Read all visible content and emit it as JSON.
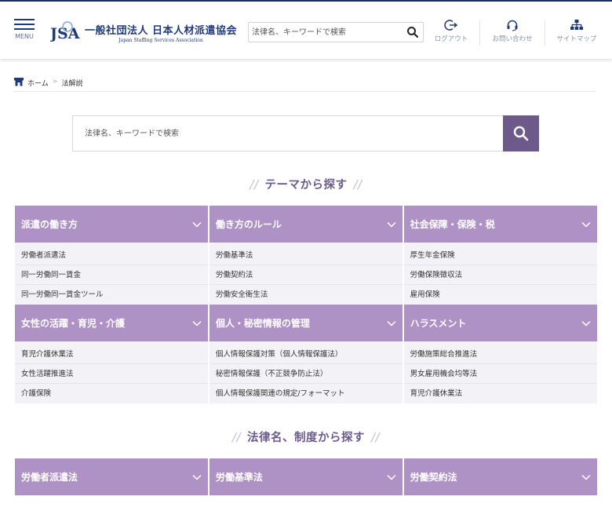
{
  "header": {
    "menu_label": "MENU",
    "logo_mark": "JSA",
    "logo_jp": "一般社団法人 日本人材派遣協会",
    "logo_en": "Japan Staffing Services Association",
    "search_placeholder": "法律名、キーワードで検索",
    "links": [
      {
        "label": "ログアウト",
        "icon": "logout-icon"
      },
      {
        "label": "お問い合わせ",
        "icon": "headset-icon"
      },
      {
        "label": "サイトマップ",
        "icon": "sitemap-icon"
      }
    ]
  },
  "breadcrumb": {
    "home": "ホーム",
    "separator": ">",
    "current": "法解説"
  },
  "search": {
    "placeholder": "法律名、キーワードで検索"
  },
  "theme_section": {
    "title": "テーマから探す",
    "rows": [
      [
        {
          "title": "派遣の働き方",
          "items": [
            "労働者派遣法",
            "同一労働同一賃金",
            "同一労働同一賃金ツール"
          ]
        },
        {
          "title": "働き方のルール",
          "items": [
            "労働基準法",
            "労働契約法",
            "労働安全衛生法"
          ]
        },
        {
          "title": "社会保障・保険・税",
          "items": [
            "厚生年金保険",
            "労働保険徴収法",
            "雇用保険"
          ]
        }
      ],
      [
        {
          "title": "女性の活躍・育児・介護",
          "items": [
            "育児介護休業法",
            "女性活躍推進法",
            "介護保険"
          ]
        },
        {
          "title": "個人・秘密情報の管理",
          "items": [
            "個人情報保護対策（個人情報保護法）",
            "秘密情報保護（不正競争防止法）",
            "個人情報保護関連の規定/フォーマット"
          ]
        },
        {
          "title": "ハラスメント",
          "items": [
            "労働施策総合推進法",
            "男女雇用機会均等法",
            "育児介護休業法"
          ]
        }
      ]
    ]
  },
  "law_section": {
    "title": "法律名、制度から探す",
    "rows": [
      [
        {
          "title": "労働者派遣法"
        },
        {
          "title": "労働基準法"
        },
        {
          "title": "労働契約法"
        }
      ]
    ]
  },
  "colors": {
    "accent": "#ae92c5",
    "title": "#6b5a8e",
    "search_button": "#6e5a8a",
    "brand_navy": "#1f3a78"
  }
}
